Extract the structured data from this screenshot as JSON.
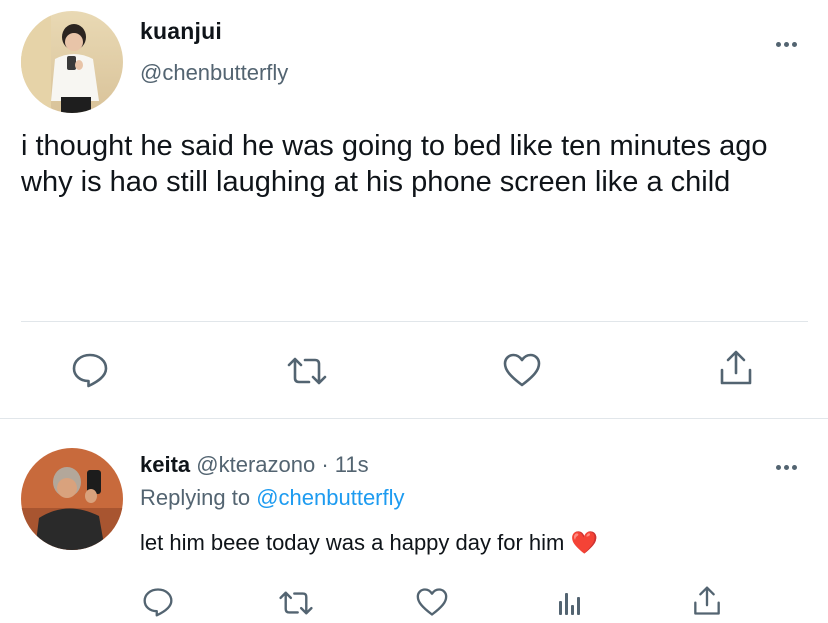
{
  "main_tweet": {
    "author_name": "kuanjui",
    "author_handle": "@chenbutterfly",
    "text": "i thought he said he was going to bed like ten minutes ago why is hao still laughing at his phone screen like a child"
  },
  "reply": {
    "author_name": "keita",
    "meta": "@kterazono · 11s",
    "replying_label": "Replying to",
    "replying_handle": "@chenbutterfly",
    "text": "let him beee today was a happy day for him",
    "emoji": "❤️"
  },
  "icons": {
    "reply": "comment-bubble-icon",
    "retweet": "retweet-icon",
    "like": "heart-icon",
    "share": "share-upload-icon",
    "analytics": "analytics-bars-icon",
    "more": "ellipsis-icon"
  },
  "colors": {
    "text_primary": "#0f1419",
    "text_secondary": "#536471",
    "link": "#1d9bf0",
    "divider": "#e1e6ea"
  }
}
